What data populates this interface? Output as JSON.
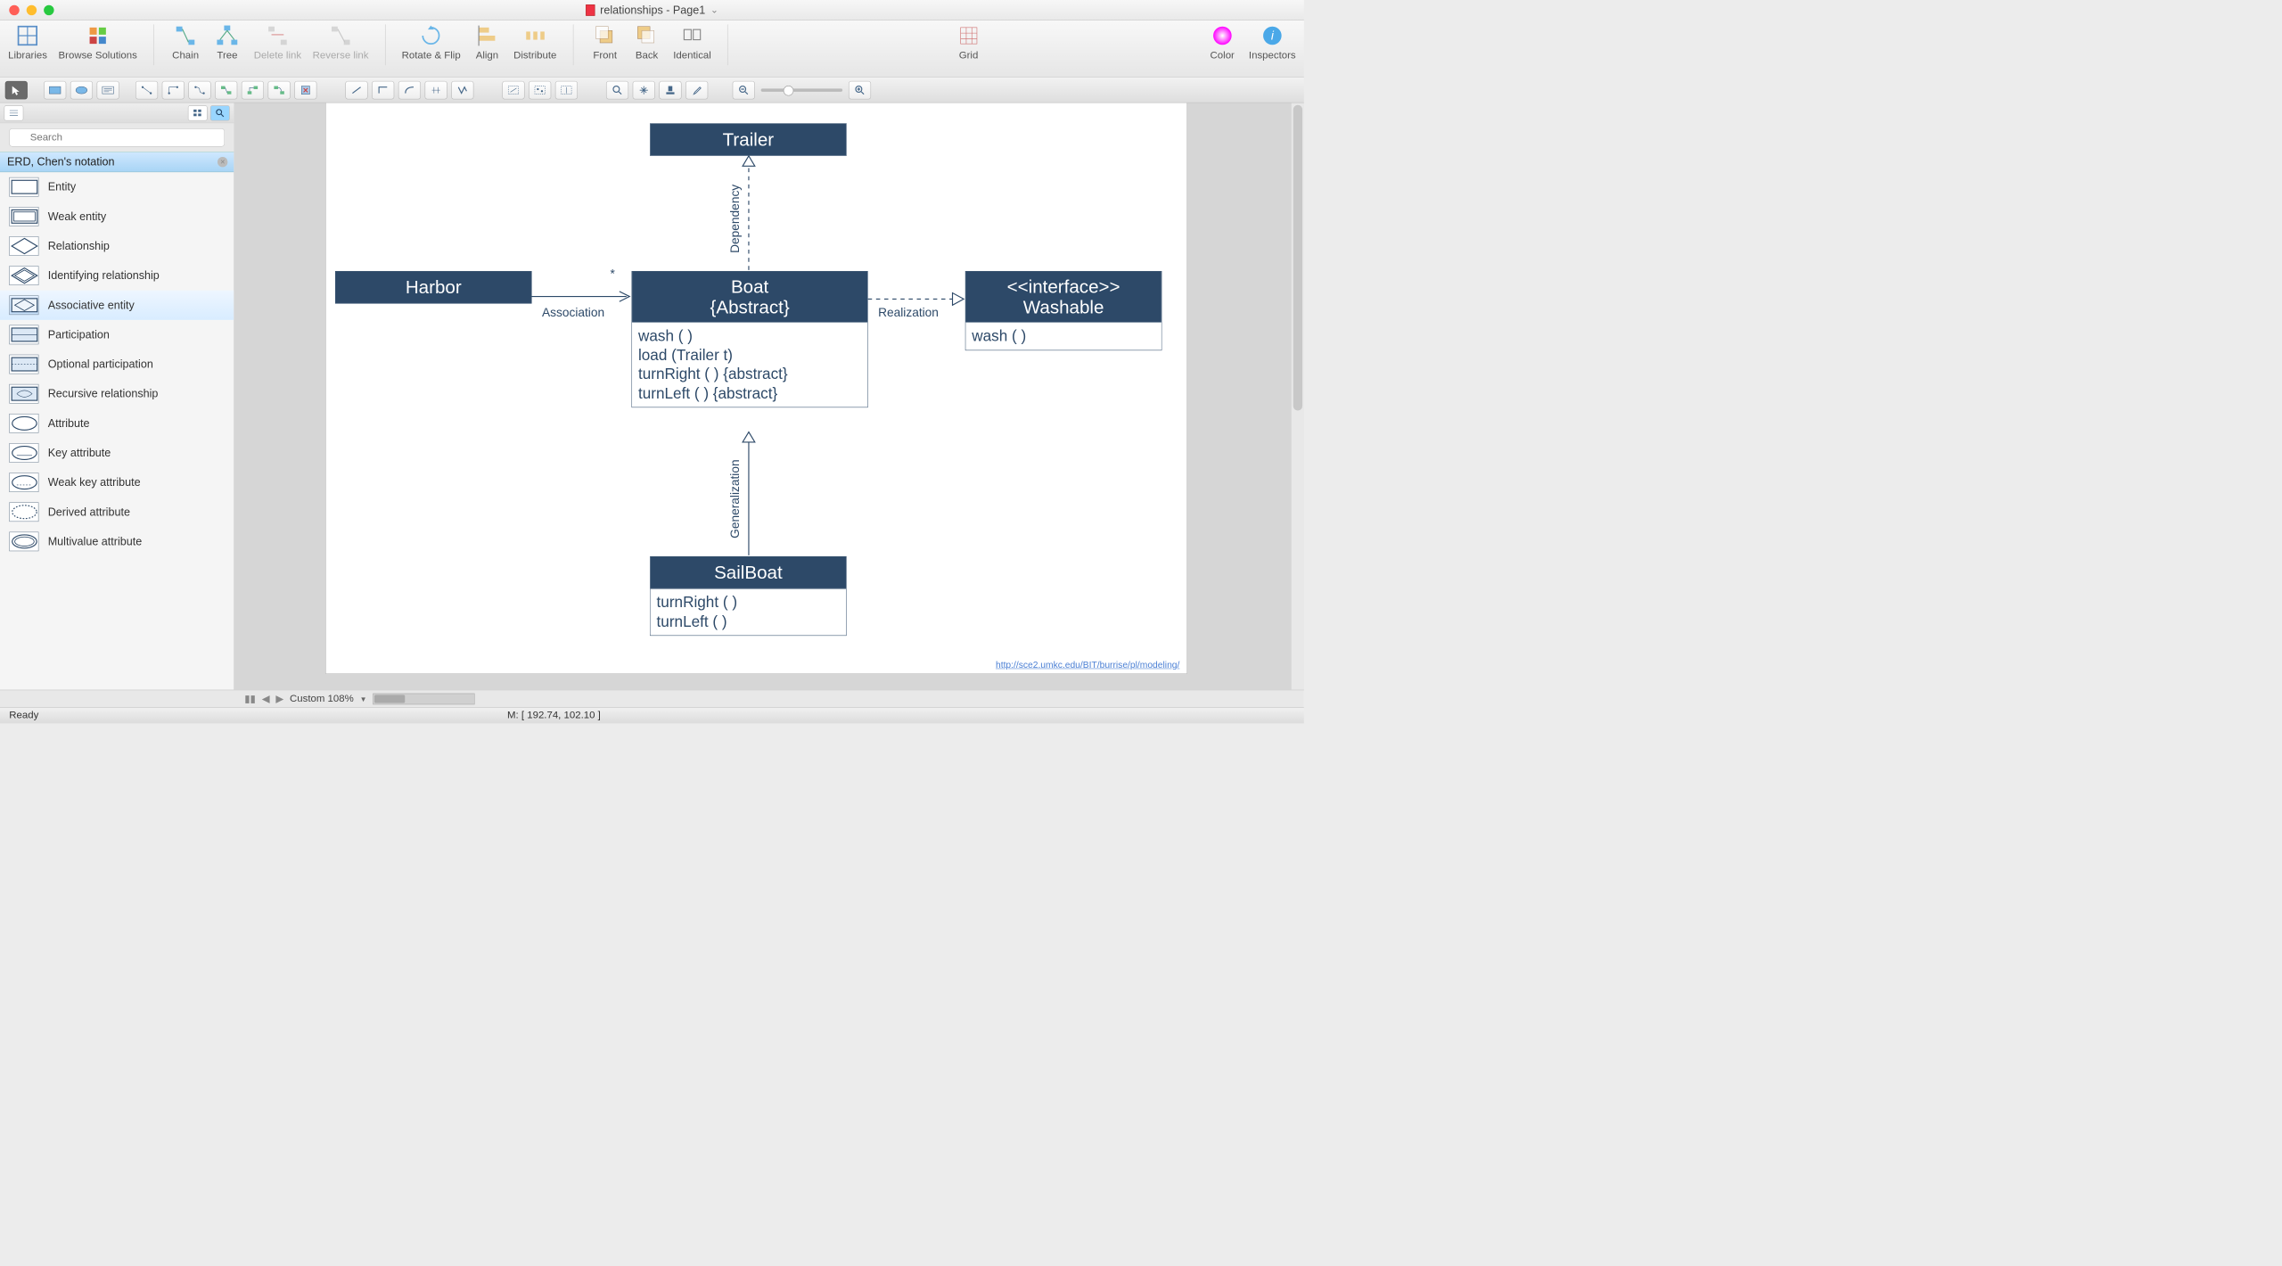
{
  "window": {
    "title": "relationships - Page1"
  },
  "toolbar": {
    "libraries": "Libraries",
    "browse": "Browse Solutions",
    "chain": "Chain",
    "tree": "Tree",
    "delete_link": "Delete link",
    "reverse_link": "Reverse link",
    "rotate_flip": "Rotate & Flip",
    "align": "Align",
    "distribute": "Distribute",
    "front": "Front",
    "back": "Back",
    "identical": "Identical",
    "grid": "Grid",
    "color": "Color",
    "inspectors": "Inspectors"
  },
  "sidebar": {
    "search_placeholder": "Search",
    "lib_title": "ERD, Chen's notation",
    "items": [
      {
        "label": "Entity"
      },
      {
        "label": "Weak entity"
      },
      {
        "label": "Relationship"
      },
      {
        "label": "Identifying relationship"
      },
      {
        "label": "Associative entity"
      },
      {
        "label": "Participation"
      },
      {
        "label": "Optional participation"
      },
      {
        "label": "Recursive relationship"
      },
      {
        "label": "Attribute"
      },
      {
        "label": "Key attribute"
      },
      {
        "label": "Weak key attribute"
      },
      {
        "label": "Derived attribute"
      },
      {
        "label": "Multivalue attribute"
      }
    ]
  },
  "diagram": {
    "trailer": "Trailer",
    "harbor": "Harbor",
    "boat_line1": "Boat",
    "boat_line2": "{Abstract}",
    "boat_ops": [
      "wash ( )",
      "load (Trailer t)",
      "turnRight ( ) {abstract}",
      "turnLeft ( ) {abstract}"
    ],
    "washable_line1": "<<interface>>",
    "washable_line2": "Washable",
    "washable_ops": [
      "wash ( )"
    ],
    "sailboat": "SailBoat",
    "sailboat_ops": [
      "turnRight ( )",
      "turnLeft ( )"
    ],
    "assoc": "Association",
    "star": "*",
    "dep": "Dependency",
    "gen": "Generalization",
    "real": "Realization",
    "url": "http://sce2.umkc.edu/BIT/burrise/pl/modeling/"
  },
  "bottom": {
    "zoom": "Custom 108%"
  },
  "status": {
    "ready": "Ready",
    "mouse": "M: [ 192.74, 102.10 ]"
  }
}
